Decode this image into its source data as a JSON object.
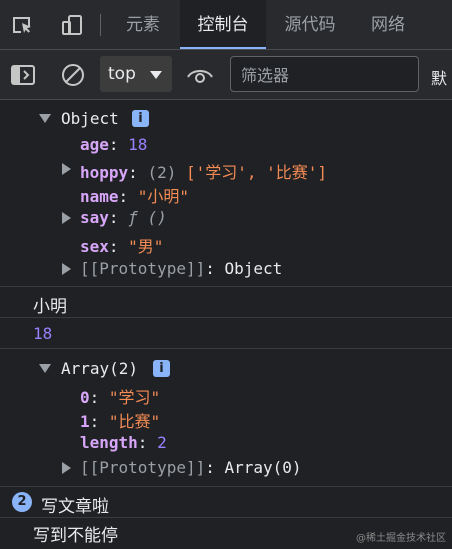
{
  "tabs": [
    "元素",
    "控制台",
    "源代码",
    "网络"
  ],
  "toolbar": {
    "context": "top",
    "filter_placeholder": "筛选器",
    "cut_label": "默"
  },
  "object_log": {
    "header": "Object",
    "info_badge": "i",
    "props": [
      {
        "key": "age",
        "value": "18"
      },
      {
        "key": "hoppy",
        "count": "(2)",
        "value": "['学习', '比赛']"
      },
      {
        "key": "name",
        "value": "\"小明\""
      },
      {
        "key": "say",
        "value": "ƒ ()"
      },
      {
        "key": "sex",
        "value": "\"男\""
      }
    ],
    "prototype_key": "[[Prototype]]",
    "prototype_value": "Object"
  },
  "log_name": "小明",
  "log_age": "18",
  "array_log": {
    "header": "Array(2)",
    "info_badge": "i",
    "items": [
      {
        "key": "0",
        "value": "\"学习\""
      },
      {
        "key": "1",
        "value": "\"比赛\""
      },
      {
        "key": "length",
        "value": "2"
      }
    ],
    "prototype_key": "[[Prototype]]",
    "prototype_value": "Array(0)"
  },
  "grouped_log": {
    "count": "2",
    "text": "写文章啦"
  },
  "last_log": "写到不能停",
  "watermark": "@稀土掘金技术社区"
}
